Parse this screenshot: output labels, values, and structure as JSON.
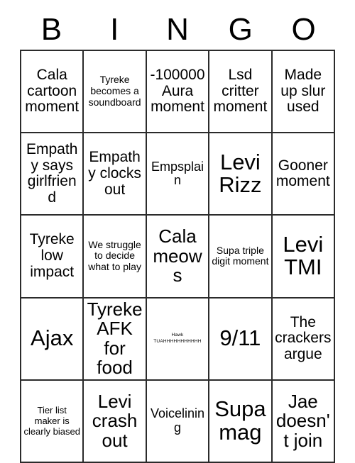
{
  "card": {
    "title": "BINGO",
    "header_letters": [
      "B",
      "I",
      "N",
      "G",
      "O"
    ],
    "grid_size": 5,
    "colors": {
      "background": "#ffffff",
      "grid_line": "#2b2b2b",
      "text": "#000000"
    },
    "cells": [
      {
        "text": "Cala cartoon moment",
        "size": "lg",
        "row": 1,
        "col": 1,
        "marked": false
      },
      {
        "text": "Tyreke becomes a soundboard",
        "size": "sm",
        "row": 1,
        "col": 2,
        "marked": false
      },
      {
        "text": "-100000 Aura moment",
        "size": "lg",
        "row": 1,
        "col": 3,
        "marked": false
      },
      {
        "text": "Lsd critter moment",
        "size": "lg",
        "row": 1,
        "col": 4,
        "marked": false
      },
      {
        "text": "Made up slur used",
        "size": "lg",
        "row": 1,
        "col": 5,
        "marked": false
      },
      {
        "text": "Empathy says girlfriend",
        "size": "lg",
        "row": 2,
        "col": 1,
        "marked": false
      },
      {
        "text": "Empathy clocks out",
        "size": "lg",
        "row": 2,
        "col": 2,
        "marked": false
      },
      {
        "text": "Empsplain",
        "size": "md",
        "row": 2,
        "col": 3,
        "marked": false
      },
      {
        "text": "Levi Rizz",
        "size": "xxl",
        "row": 2,
        "col": 4,
        "marked": false
      },
      {
        "text": "Gooner moment",
        "size": "lg",
        "row": 2,
        "col": 5,
        "marked": false
      },
      {
        "text": "Tyreke low impact",
        "size": "lg",
        "row": 3,
        "col": 1,
        "marked": false
      },
      {
        "text": "We struggle to decide what to play",
        "size": "sm",
        "row": 3,
        "col": 2,
        "marked": false
      },
      {
        "text": "Cala meows",
        "size": "xl",
        "row": 3,
        "col": 3,
        "marked": false
      },
      {
        "text": "Supa triple digit moment",
        "size": "sm",
        "row": 3,
        "col": 4,
        "marked": false
      },
      {
        "text": "Levi TMI",
        "size": "xxl",
        "row": 3,
        "col": 5,
        "marked": false
      },
      {
        "text": "Ajax",
        "size": "xxl",
        "row": 4,
        "col": 1,
        "marked": false
      },
      {
        "text": "Tyreke AFK for food",
        "size": "xl",
        "row": 4,
        "col": 2,
        "marked": false
      },
      {
        "text": "Hawk TUAHHHHHHHHHHH",
        "size": "tiny",
        "row": 4,
        "col": 3,
        "marked": false
      },
      {
        "text": "9/11",
        "size": "xxl",
        "row": 4,
        "col": 4,
        "marked": false
      },
      {
        "text": "The crackers argue",
        "size": "lg",
        "row": 4,
        "col": 5,
        "marked": false
      },
      {
        "text": "Tier list maker is clearly biased",
        "size": "xs",
        "row": 5,
        "col": 1,
        "marked": false
      },
      {
        "text": "Levi crash out",
        "size": "xl",
        "row": 5,
        "col": 2,
        "marked": false
      },
      {
        "text": "Voicelining",
        "size": "md",
        "row": 5,
        "col": 3,
        "marked": false
      },
      {
        "text": "Supa mag",
        "size": "xxl",
        "row": 5,
        "col": 4,
        "marked": false
      },
      {
        "text": "Jae doesn't join",
        "size": "xl",
        "row": 5,
        "col": 5,
        "marked": false
      }
    ]
  }
}
